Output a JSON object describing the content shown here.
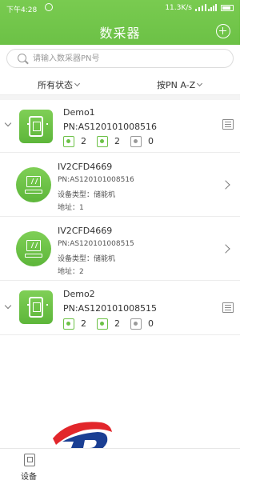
{
  "status_bar": {
    "time": "下午4:28",
    "speed": "11.3K/s"
  },
  "header": {
    "title": "数采器"
  },
  "search": {
    "placeholder": "请输入数采器PN号"
  },
  "filters": {
    "status_label": "所有状态",
    "sort_label": "按PN A-Z"
  },
  "collectors": [
    {
      "name": "Demo1",
      "pn": "PN:AS120101008516",
      "stats": [
        {
          "icon": "user-icon",
          "value": "2"
        },
        {
          "icon": "person-icon",
          "value": "2"
        },
        {
          "icon": "empty-user-icon",
          "value": "0"
        }
      ]
    },
    {
      "name": "Demo2",
      "pn": "PN:AS120101008515",
      "stats": [
        {
          "icon": "user-icon",
          "value": "2"
        },
        {
          "icon": "person-icon",
          "value": "2"
        },
        {
          "icon": "empty-user-icon",
          "value": "0"
        }
      ]
    }
  ],
  "devices": [
    {
      "title": "IV2CFD4669",
      "pn": "PN:AS120101008516",
      "type": "设备类型：储能机",
      "address": "地址：1"
    },
    {
      "title": "IV2CFD4669",
      "pn": "PN:AS120101008515",
      "type": "设备类型：储能机",
      "address": "地址：2"
    }
  ],
  "bottom_nav": {
    "device_label": "设备"
  },
  "colors": {
    "accent": "#6cc146",
    "background": "#ffffff"
  }
}
